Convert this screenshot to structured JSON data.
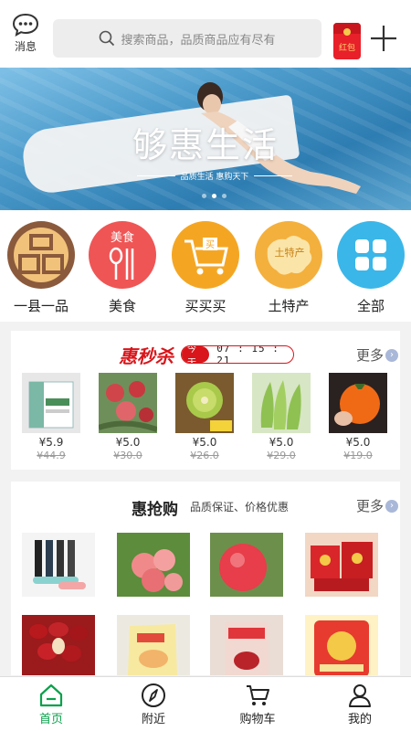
{
  "header": {
    "message_label": "消息",
    "search_placeholder": "搜索商品，品质商品应有尽有",
    "redpacket_label": "红包"
  },
  "banner": {
    "title": "够惠生活",
    "subtitle": "品质生活 惠购天下",
    "slide_count": 3,
    "active_slide": 2
  },
  "categories": [
    {
      "label": "一县一品",
      "icon": "county-product-icon",
      "glyph": "品"
    },
    {
      "label": "美食",
      "icon": "food-icon",
      "glyph": "美食"
    },
    {
      "label": "买买买",
      "icon": "shopping-cart-icon",
      "glyph": "买"
    },
    {
      "label": "土特产",
      "icon": "local-specialty-icon",
      "glyph": "土特产"
    },
    {
      "label": "全部",
      "icon": "grid-icon",
      "glyph": ""
    }
  ],
  "seckill": {
    "title": "惠秒杀",
    "timer_label": "今天",
    "timer": "07 : 15 : 21",
    "more_label": "更多",
    "items": [
      {
        "price": "¥5.9",
        "old_price": "¥44.9",
        "image": "packaged-product-box"
      },
      {
        "price": "¥5.0",
        "old_price": "¥30.0",
        "image": "apples-on-tree"
      },
      {
        "price": "¥5.0",
        "old_price": "¥26.0",
        "image": "kiwi-fruit"
      },
      {
        "price": "¥5.0",
        "old_price": "¥29.0",
        "image": "green-bananas"
      },
      {
        "price": "¥5.0",
        "old_price": "¥19.0",
        "image": "orange-persimmon"
      }
    ]
  },
  "rush": {
    "title": "惠抢购",
    "subtitle": "品质保证、价格优惠",
    "more_label": "更多",
    "items": [
      {
        "image": "bottled-products"
      },
      {
        "image": "apples-sliced"
      },
      {
        "image": "red-apple"
      },
      {
        "image": "red-gift-boxes"
      },
      {
        "image": "red-dates"
      },
      {
        "image": "bagged-snack"
      },
      {
        "image": "red-date-package"
      },
      {
        "image": "snack-bag"
      }
    ]
  },
  "tabbar": {
    "tabs": [
      {
        "label": "首页",
        "icon": "home-icon",
        "active": true
      },
      {
        "label": "附近",
        "icon": "compass-icon",
        "active": false
      },
      {
        "label": "购物车",
        "icon": "cart-icon",
        "active": false
      },
      {
        "label": "我的",
        "icon": "user-icon",
        "active": false
      }
    ]
  },
  "colors": {
    "accent_green": "#0aa14b",
    "seckill_red": "#d8161b"
  }
}
